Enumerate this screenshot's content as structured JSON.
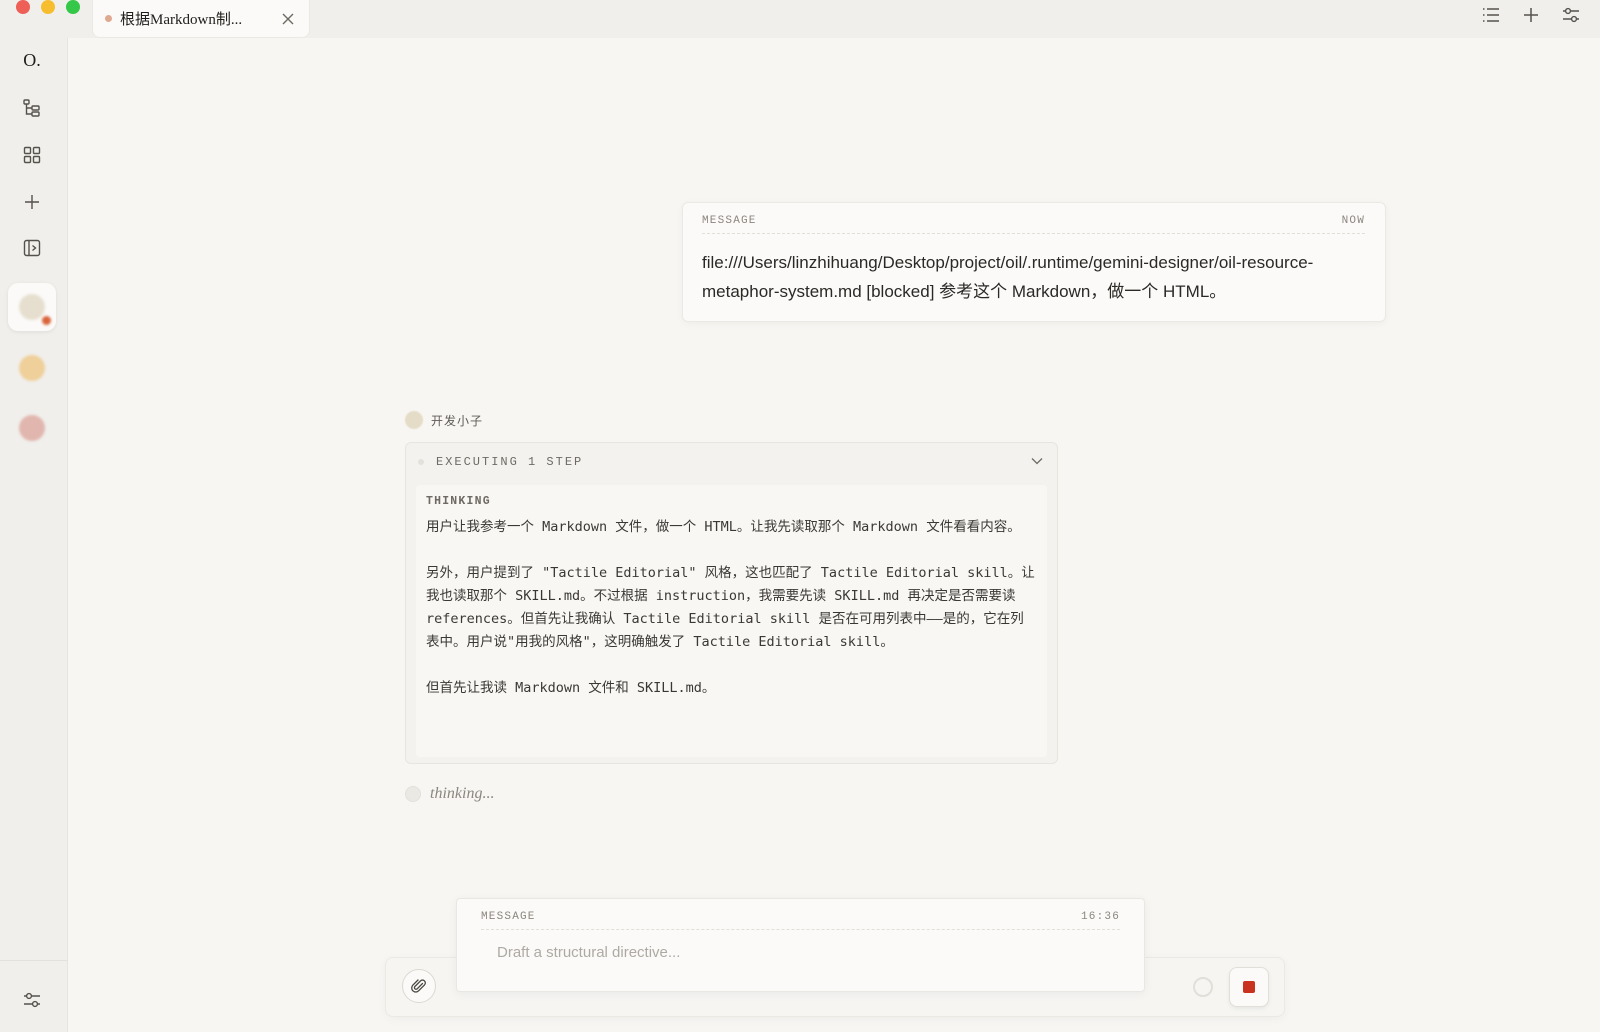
{
  "window": {
    "tab_title": "根据Markdown制...",
    "colors": {
      "close": "#ee5f58",
      "minimize": "#f6bd2e",
      "zoom": "#34c748",
      "accent_stop": "#c9321f"
    }
  },
  "toolbar": {
    "icons": [
      "list-icon",
      "plus-icon",
      "sliders-icon"
    ]
  },
  "rail": {
    "logo": "O.",
    "icons": [
      "tree-icon",
      "grid-icon",
      "plus-icon",
      "panel-icon",
      "settings-icon"
    ],
    "agents": [
      {
        "color": "#e6dfcf",
        "active": true
      },
      {
        "color": "#efcf9a",
        "active": false
      },
      {
        "color": "#e1b6ae",
        "active": false
      }
    ]
  },
  "user_message": {
    "label": "MESSAGE",
    "time": "NOW",
    "text": "file:///Users/linzhihuang/Desktop/project/oil/.runtime/gemini-designer/oil-resource-metaphor-system.md [blocked] 参考这个 Markdown，做一个 HTML。"
  },
  "agent": {
    "name": "开发小子",
    "execution": {
      "label": "EXECUTING 1 STEP",
      "thinking_title": "THINKING",
      "paragraphs": [
        "用户让我参考一个 Markdown 文件，做一个 HTML。让我先读取那个 Markdown 文件看看内容。",
        "另外，用户提到了 \"Tactile Editorial\" 风格，这也匹配了 Tactile Editorial skill。让我也读取那个 SKILL.md。不过根据 instruction，我需要先读 SKILL.md 再决定是否需要读 references。但首先让我确认 Tactile Editorial skill 是否在可用列表中——是的，它在列表中。用户说\"用我的风格\"，这明确触发了 Tactile Editorial skill。",
        "但首先让我读 Markdown 文件和 SKILL.md。"
      ]
    },
    "status_text": "thinking..."
  },
  "composer": {
    "label": "MESSAGE",
    "time": "16:36",
    "placeholder": "Draft a structural directive..."
  }
}
